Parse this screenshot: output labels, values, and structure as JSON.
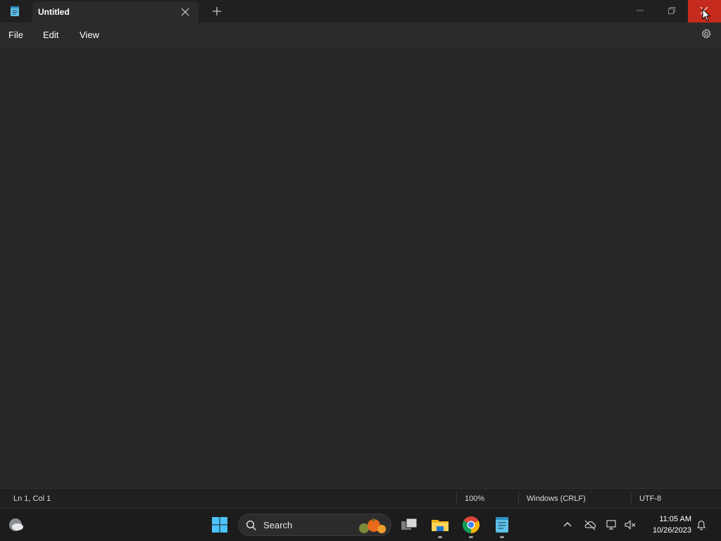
{
  "tab": {
    "title": "Untitled"
  },
  "menu": {
    "file": "File",
    "edit": "Edit",
    "view": "View"
  },
  "status": {
    "position": "Ln 1, Col 1",
    "zoom": "100%",
    "line_ending": "Windows (CRLF)",
    "encoding": "UTF-8"
  },
  "taskbar": {
    "search_label": "Search",
    "time": "11:05 AM",
    "date": "10/26/2023"
  },
  "icons": {
    "app": "notepad-icon",
    "tab_close": "close-icon",
    "new_tab": "plus-icon",
    "minimize": "minimize-icon",
    "maximize": "maximize-icon",
    "close": "close-icon",
    "settings": "gear-icon",
    "weather": "weather-icon",
    "start": "windows-start-icon",
    "search": "search-icon",
    "taskview": "task-view-icon",
    "explorer": "file-explorer-icon",
    "chrome": "chrome-icon",
    "notepad": "notepad-icon",
    "tray_chevron": "chevron-up-icon",
    "onedrive": "onedrive-icon",
    "network": "network-icon",
    "volume": "volume-muted-icon",
    "notifications": "bell-icon"
  },
  "colors": {
    "close_hover": "#c42b1c",
    "window_bg": "#272727",
    "titlebar_bg": "#202020",
    "taskbar_bg": "#1c1c1c"
  }
}
